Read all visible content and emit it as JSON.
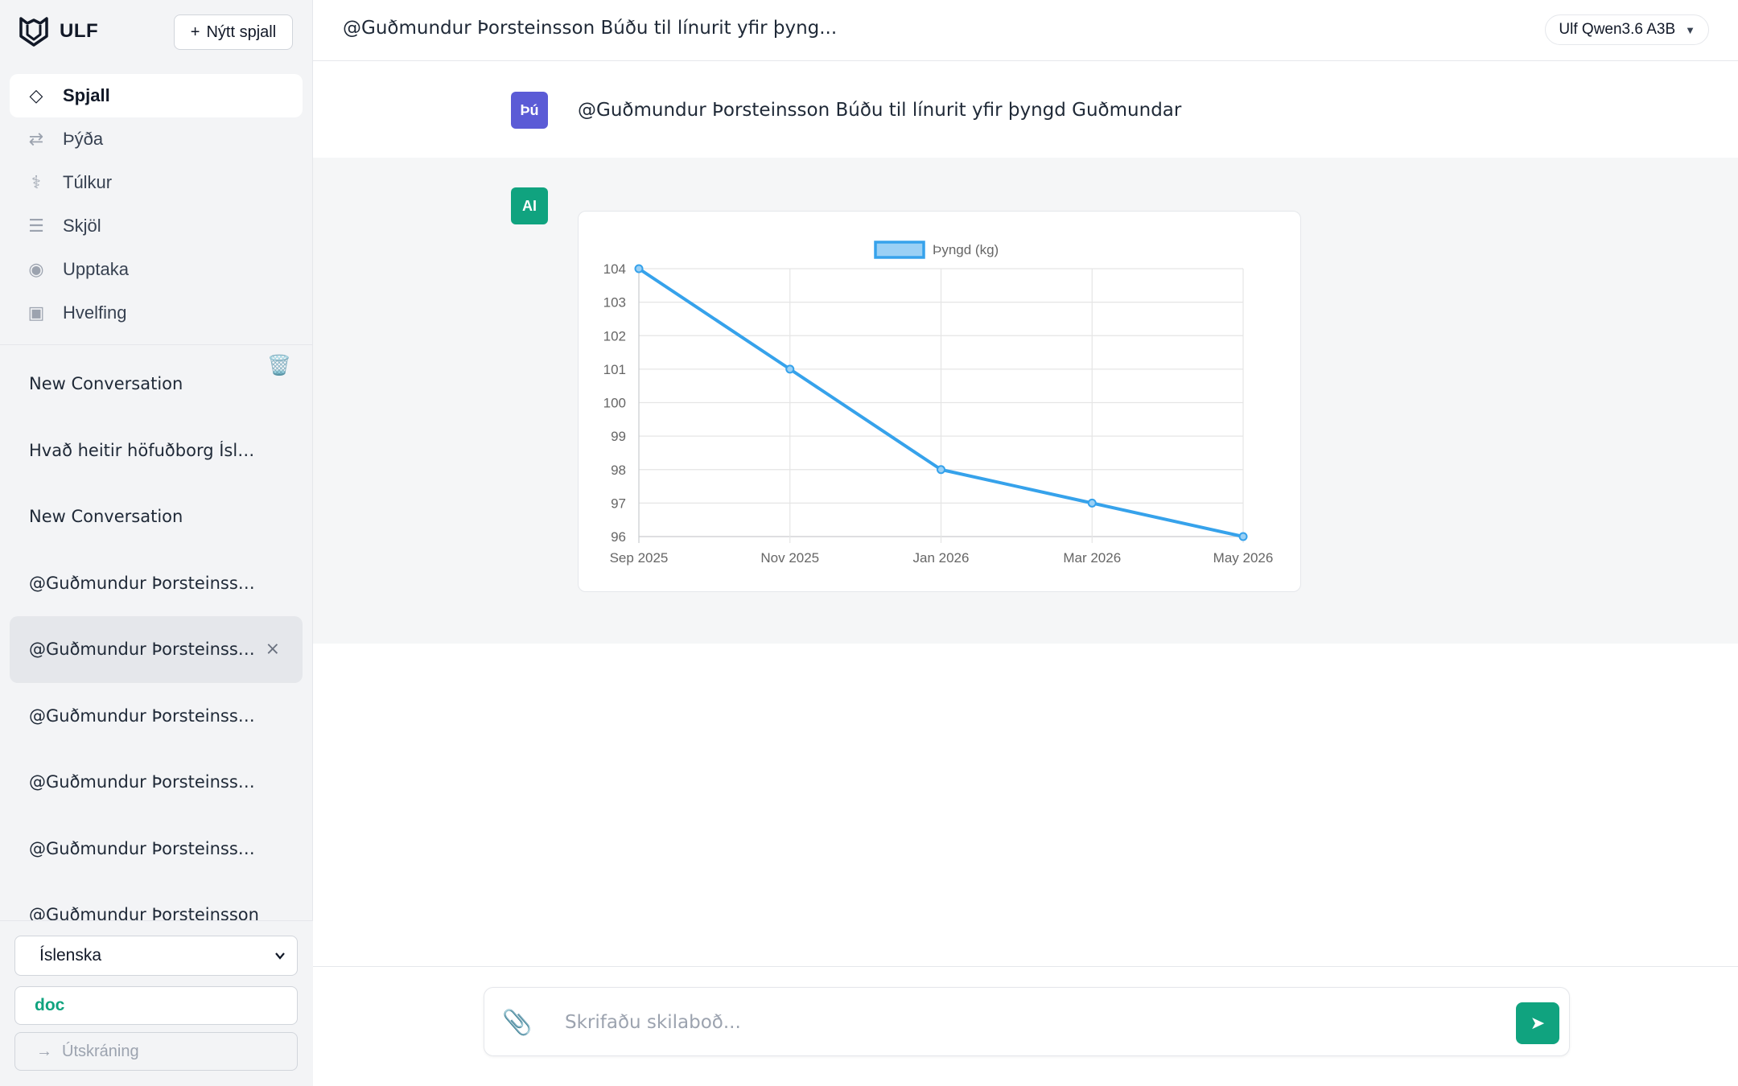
{
  "app": {
    "brand": "ULF",
    "new_chat_label": "Nýtt spjall",
    "new_chat_icon": "+"
  },
  "nav": [
    {
      "id": "spjall",
      "label": "Spjall",
      "icon": "◇",
      "active": true
    },
    {
      "id": "thyda",
      "label": "Þýða",
      "icon": "⇄",
      "active": false
    },
    {
      "id": "tulkur",
      "label": "Túlkur",
      "icon": "⚕",
      "active": false
    },
    {
      "id": "skjol",
      "label": "Skjöl",
      "icon": "☰",
      "active": false
    },
    {
      "id": "upptaka",
      "label": "Upptaka",
      "icon": "◉",
      "active": false
    },
    {
      "id": "hvelfing",
      "label": "Hvelfing",
      "icon": "▣",
      "active": false
    }
  ],
  "sidebar": {
    "trash_icon": "🗑️",
    "conversations": [
      {
        "title": "New Conversation",
        "active": false
      },
      {
        "title": "Hvað heitir höfuðborg Íslands?",
        "active": false
      },
      {
        "title": "New Conversation",
        "active": false
      },
      {
        "title": "@Guðmundur Þorsteinsson Búðu til línurit",
        "active": false
      },
      {
        "title": "@Guðmundur Þorsteinsson Búðu til línurit",
        "active": true
      },
      {
        "title": "@Guðmundur Þorsteinsson Búðu til línurit",
        "active": false
      },
      {
        "title": "@Guðmundur Þorsteinsson Búðu til línurit",
        "active": false
      },
      {
        "title": "@Guðmundur Þorsteinsson Búðu til línurit",
        "active": false
      },
      {
        "title": "@Guðmundur Þorsteinsson",
        "active": false
      }
    ],
    "close_icon": "×",
    "language_selected": "Íslenska",
    "doc_label": "doc",
    "logout_icon": "→",
    "logout_label": "Útskráning"
  },
  "topbar": {
    "title": "@Guðmundur Þorsteinsson Búðu til línurit yfir þyng...",
    "model": "Ulf Qwen3.6 A3B",
    "model_caret": "▼"
  },
  "messages": {
    "user_avatar": "Þú",
    "user_text": "@Guðmundur Þorsteinsson Búðu til línurit yfir þyngd Guðmundar",
    "ai_avatar": "AI"
  },
  "composer": {
    "placeholder": "Skrifaðu skilaboð...",
    "attach_icon": "📎",
    "send_icon": "➤"
  },
  "colors": {
    "accent": "#10a37f",
    "user_avatar": "#5b5bd6",
    "line": "#36a2eb",
    "legend_fill": "#9ad0f5"
  },
  "chart_data": {
    "type": "line",
    "title": "",
    "categories": [
      "Sep 2025",
      "Nov 2025",
      "Jan 2026",
      "Mar 2026",
      "May 2026"
    ],
    "series": [
      {
        "name": "Þyngd (kg)",
        "values": [
          104,
          101,
          98,
          97,
          96
        ]
      }
    ],
    "ylim": [
      96,
      104
    ],
    "yticks": [
      "104",
      "103",
      "102",
      "101",
      "100",
      "99",
      "98",
      "97",
      "96"
    ],
    "grid": true,
    "legend": "top-center"
  }
}
